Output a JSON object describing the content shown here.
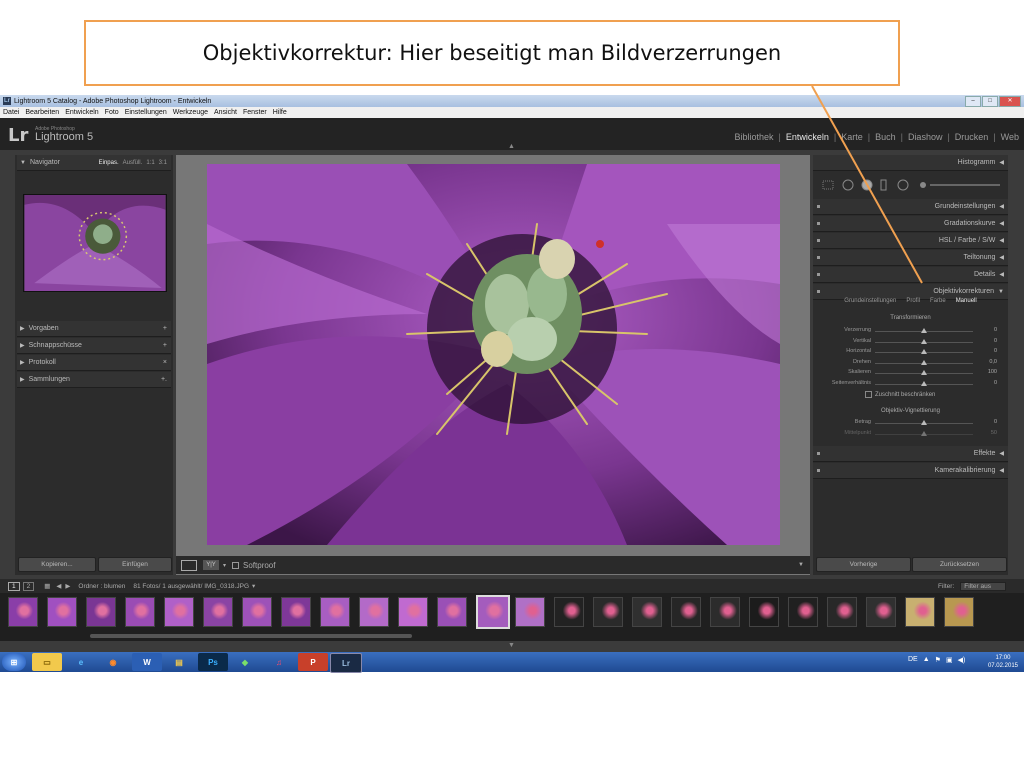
{
  "callout": {
    "text": "Objektivkorrektur: Hier beseitigt man Bildverzerrungen"
  },
  "window": {
    "title": "Lightroom 5 Catalog - Adobe Photoshop Lightroom - Entwickeln",
    "menu": [
      "Datei",
      "Bearbeiten",
      "Entwickeln",
      "Foto",
      "Einstellungen",
      "Werkzeuge",
      "Ansicht",
      "Fenster",
      "Hilfe"
    ]
  },
  "brand": {
    "logo": "Lr",
    "small": "Adobe Photoshop",
    "big": "Lightroom 5"
  },
  "modules": [
    "Bibliothek",
    "Entwickeln",
    "Karte",
    "Buch",
    "Diashow",
    "Drucken",
    "Web"
  ],
  "left_panel": {
    "navigator": {
      "label": "Navigator",
      "zoom": [
        "Einpas.",
        "Ausfüll.",
        "1:1",
        "3:1"
      ]
    },
    "sections": [
      {
        "label": "Vorgaben",
        "action": "+"
      },
      {
        "label": "Schnappschüsse",
        "action": "+"
      },
      {
        "label": "Protokoll",
        "action": "×"
      },
      {
        "label": "Sammlungen",
        "action": "+."
      }
    ],
    "copy_button": "Kopieren...",
    "paste_button": "Einfügen"
  },
  "toolbar": {
    "softproof": "Softproof"
  },
  "right_panel": {
    "histogram": "Histogramm",
    "panels_top": [
      "Grundeinstellungen",
      "Gradationskurve",
      "HSL / Farbe / S/W",
      "Teiltonung",
      "Details",
      "Objektivkorrekturen"
    ],
    "lens_tabs": [
      "Grundeinstellungen",
      "Profil",
      "Farbe",
      "Manuell"
    ],
    "transform_title": "Transformieren",
    "transform_sliders": [
      {
        "label": "Verzerrung",
        "value": "0",
        "pos": 0.5
      },
      {
        "label": "Vertikal",
        "value": "0",
        "pos": 0.5
      },
      {
        "label": "Horizontal",
        "value": "0",
        "pos": 0.5
      },
      {
        "label": "Drehen",
        "value": "0,0",
        "pos": 0.5
      },
      {
        "label": "Skalieren",
        "value": "100",
        "pos": 0.5
      },
      {
        "label": "Seitenverhältnis",
        "value": "0",
        "pos": 0.5
      }
    ],
    "crop_check": "Zuschnitt beschränken",
    "vignette_title": "Objektiv-Vignettierung",
    "vignette_sliders": [
      {
        "label": "Betrag",
        "value": "0",
        "pos": 0.5
      },
      {
        "label": "Mittelpunkt",
        "value": "50",
        "pos": 0.5
      }
    ],
    "panels_bottom": [
      "Effekte",
      "Kamerakalibrierung"
    ],
    "prev_button": "Vorherige",
    "reset_button": "Zurücksetzen"
  },
  "filmstrip": {
    "pages": [
      "1",
      "2"
    ],
    "source": "Ordner : blumen",
    "info": "81 Fotos/ 1 ausgewählt/ IMG_0318.JPG",
    "filter_label": "Filter:",
    "filter_value": "Filter aus"
  },
  "taskbar": {
    "lang": "DE",
    "time": "17:00",
    "date": "07.02.2015"
  },
  "colors": {
    "accent_callout": "#f0a050",
    "panel_bg": "#2c2c2c",
    "taskbar": "#2a5aa8"
  }
}
